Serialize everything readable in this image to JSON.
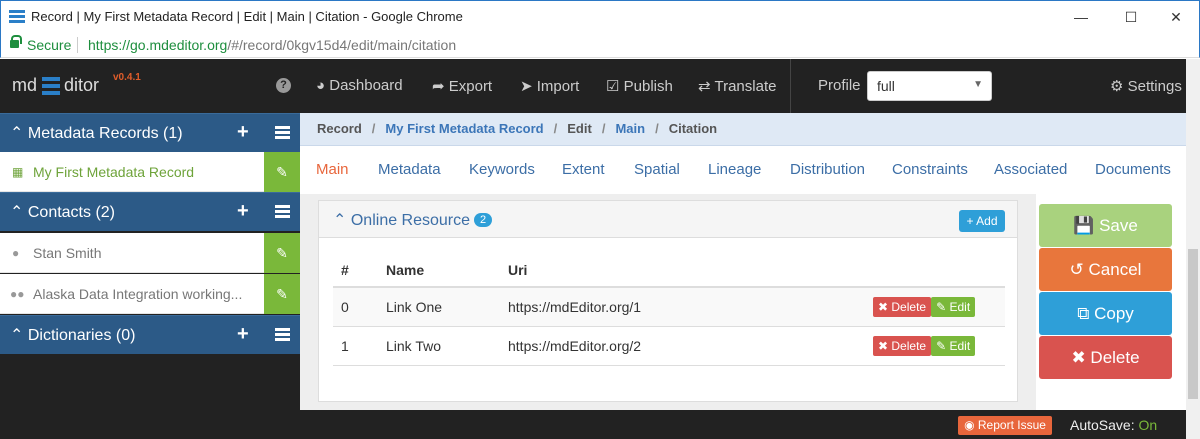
{
  "window": {
    "title": "Record | My First Metadata Record | Edit | Main | Citation - Google Chrome",
    "secure_label": "Secure",
    "url_host": "https://go.mdeditor.org",
    "url_path": "/#/record/0kgv15d4/edit/main/citation"
  },
  "brand": {
    "prefix": "md",
    "suffix": "ditor",
    "version": "v0.4.1"
  },
  "sidebar": {
    "sections": [
      {
        "label": "Metadata Records (1)"
      },
      {
        "label": "Contacts (2)"
      },
      {
        "label": "Dictionaries (0)"
      }
    ],
    "records": [
      {
        "label": "My First Metadata Record"
      }
    ],
    "contacts": [
      {
        "label": "Stan Smith"
      },
      {
        "label": "Alaska Data Integration working..."
      }
    ]
  },
  "topnav": {
    "items": [
      "Dashboard",
      "Export",
      "Import",
      "Publish",
      "Translate"
    ],
    "profile_label": "Profile",
    "profile_value": "full",
    "settings": "Settings"
  },
  "breadcrumb": [
    "Record",
    "My First Metadata Record",
    "Edit",
    "Main",
    "Citation"
  ],
  "tabs": [
    "Main",
    "Metadata",
    "Keywords",
    "Extent",
    "Spatial",
    "Lineage",
    "Distribution",
    "Constraints",
    "Associated",
    "Documents"
  ],
  "panel": {
    "title": "Online Resource",
    "count": "2",
    "add_label": "Add",
    "columns": [
      "#",
      "Name",
      "Uri"
    ],
    "rows": [
      {
        "idx": "0",
        "name": "Link One",
        "uri": "https://mdEditor.org/1"
      },
      {
        "idx": "1",
        "name": "Link Two",
        "uri": "https://mdEditor.org/2"
      }
    ],
    "delete_label": "Delete",
    "edit_label": "Edit"
  },
  "actions": {
    "save": "Save",
    "cancel": "Cancel",
    "copy": "Copy",
    "delete": "Delete"
  },
  "footer": {
    "report": "Report Issue",
    "autosave_label": "AutoSave:",
    "autosave_value": "On"
  },
  "colors": {
    "accent": "#2c5a87",
    "green": "#7ab83a",
    "orange": "#e8663c",
    "red": "#d9534f",
    "blue": "#2e9fd8"
  }
}
